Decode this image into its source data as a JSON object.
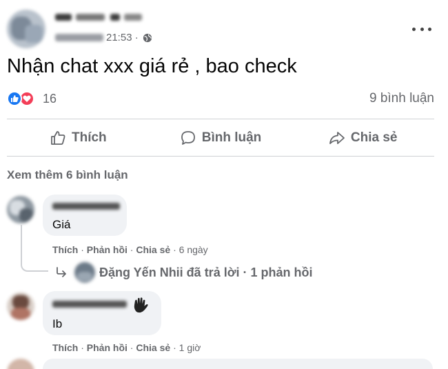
{
  "post": {
    "author_name": "",
    "timestamp_visible": "21:53 ·",
    "text": "Nhận chat xxx giá rẻ , bao check",
    "reaction_count": "16",
    "reactions": [
      "like",
      "love"
    ],
    "comment_count_label": "9 bình luận"
  },
  "actions": {
    "like_label": "Thích",
    "comment_label": "Bình luận",
    "share_label": "Chia sẻ"
  },
  "comments_section": {
    "see_more_label": "Xem thêm 6 bình luận",
    "comments": [
      {
        "author_name": "",
        "text": "Giá",
        "actions": {
          "like": "Thích",
          "reply": "Phản hồi",
          "share": "Chia sẻ",
          "time": "6 ngày"
        },
        "reply_summary": "Đặng Yến Nhii đã trả lời · 1 phản hồi"
      },
      {
        "author_name": "",
        "text": "Ib",
        "actions": {
          "like": "Thích",
          "reply": "Phản hồi",
          "share": "Chia sẻ",
          "time": "1 giờ"
        }
      }
    ]
  },
  "colors": {
    "secondary_text": "#65676b",
    "like_blue": "#1877f2",
    "love_red": "#f33e58",
    "bubble_bg": "#f0f2f5",
    "divider": "#ced0d4"
  },
  "icons": [
    "globe-icon",
    "more-icon",
    "like-reaction-icon",
    "love-reaction-icon",
    "thumbs-up-icon",
    "comment-icon",
    "share-icon",
    "reply-arrow-icon",
    "wave-hand-icon"
  ]
}
